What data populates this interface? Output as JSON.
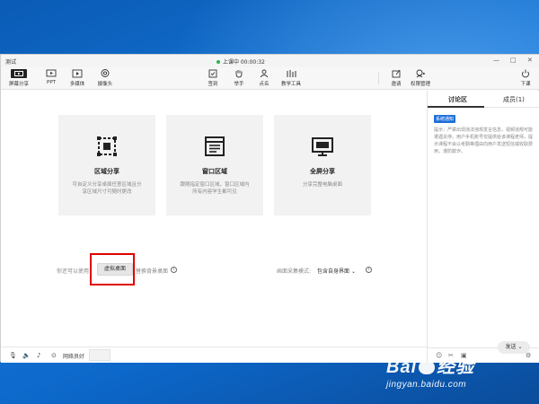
{
  "window": {
    "title": "测试",
    "live_status": "上课中 00:00:32",
    "controls": [
      "minimize-icon",
      "maximize-icon",
      "close-icon"
    ]
  },
  "toolbar": {
    "left_tools": [
      {
        "label": "屏幕分享",
        "icon": "screen-share-icon",
        "active": true
      },
      {
        "label": "PPT",
        "icon": "ppt-icon"
      },
      {
        "label": "多媒体",
        "icon": "media-icon"
      },
      {
        "label": "摄像头",
        "icon": "camera-icon"
      }
    ],
    "center_tools": [
      {
        "label": "签到",
        "icon": "signin-icon"
      },
      {
        "label": "举手",
        "icon": "raise-hand-icon"
      },
      {
        "label": "点名",
        "icon": "roll-call-icon"
      },
      {
        "label": "教学工具",
        "icon": "teaching-tools-icon"
      }
    ],
    "right_tools": [
      {
        "label": "邀请",
        "icon": "invite-icon"
      },
      {
        "label": "权限管理",
        "icon": "permission-icon"
      },
      {
        "label": "下课",
        "icon": "end-class-icon"
      }
    ]
  },
  "share_options": [
    {
      "title": "区域分享",
      "desc": "可自定义分享桌面任意区域且分享区域尺寸可随时更改",
      "icon": "region-share-icon"
    },
    {
      "title": "窗口区域",
      "desc": "跟随指定窗口区域，窗口区域内所有内容学生都可见",
      "icon": "window-share-icon"
    },
    {
      "title": "全屏分享",
      "desc": "分享完整电脑桌面",
      "icon": "fullscreen-share-icon"
    }
  ],
  "bottom": {
    "hint": "你还可以使用",
    "virtual_desktop": "虚拟桌面",
    "switch_bg": "替换背景桌面",
    "capture_label": "画面采集模式:",
    "capture_value": "包含自身界面"
  },
  "right_panel": {
    "tabs": [
      "讨论区",
      "成员(1)"
    ],
    "notice_badge": "系统通知",
    "notice_text": "提示：严禁出现违法违规发言信息，视频违规可能遭遇关停。用户手机账号仅提供给该课程老师，提示课程不会以考勤等理由向用户发送短信或收取费用，谨防欺诈。",
    "send": "发送"
  },
  "statusbar": {
    "network": "网络良好"
  },
  "watermark": {
    "line1": "Bai经验",
    "line2": "jingyan.baidu.com"
  }
}
